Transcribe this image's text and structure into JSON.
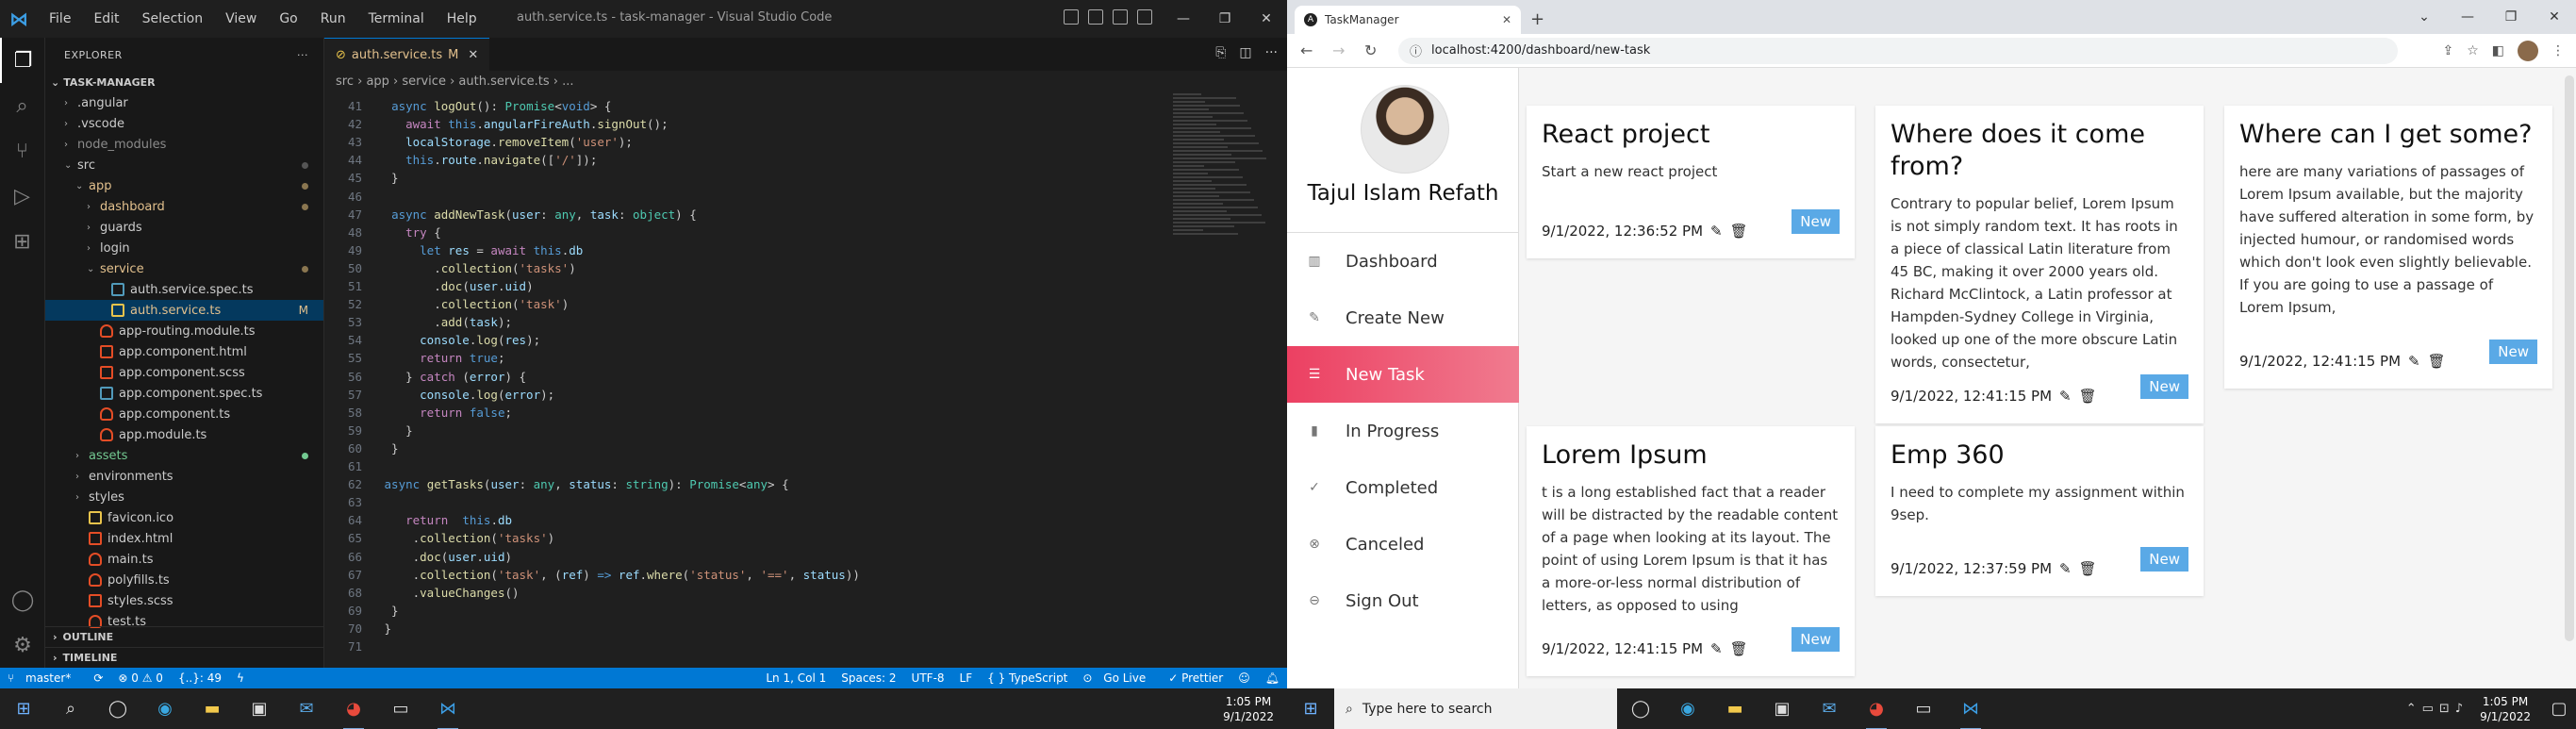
{
  "vscode": {
    "menu": [
      "File",
      "Edit",
      "Selection",
      "View",
      "Go",
      "Run",
      "Terminal",
      "Help"
    ],
    "window_title": "auth.service.ts - task-manager - Visual Studio Code",
    "explorer_title": "EXPLORER",
    "project": "TASK-MANAGER",
    "tree": [
      {
        "label": ".angular",
        "depth": 1,
        "type": "folder",
        "chev": "›"
      },
      {
        "label": ".vscode",
        "depth": 1,
        "type": "folder",
        "chev": "›"
      },
      {
        "label": "node_modules",
        "depth": 1,
        "type": "folder",
        "chev": "›",
        "dim": true
      },
      {
        "label": "src",
        "depth": 1,
        "type": "folder",
        "chev": "⌄",
        "dot": true
      },
      {
        "label": "app",
        "depth": 2,
        "type": "folder",
        "chev": "⌄",
        "dot": true,
        "color": "#e2c08d"
      },
      {
        "label": "dashboard",
        "depth": 3,
        "type": "folder",
        "chev": "›",
        "dot": true,
        "color": "#e2c08d"
      },
      {
        "label": "guards",
        "depth": 3,
        "type": "folder",
        "chev": "›"
      },
      {
        "label": "login",
        "depth": 3,
        "type": "folder",
        "chev": "›"
      },
      {
        "label": "service",
        "depth": 3,
        "type": "folder",
        "chev": "⌄",
        "dot": true,
        "color": "#e2c08d"
      },
      {
        "label": "auth.service.spec.ts",
        "depth": 4,
        "type": "spec"
      },
      {
        "label": "auth.service.ts",
        "depth": 4,
        "type": "ts",
        "badge": "M",
        "color": "#e2c08d",
        "sel": true
      },
      {
        "label": "app-routing.module.ts",
        "depth": 3,
        "type": "ng"
      },
      {
        "label": "app.component.html",
        "depth": 3,
        "type": "html"
      },
      {
        "label": "app.component.scss",
        "depth": 3,
        "type": "scss"
      },
      {
        "label": "app.component.spec.ts",
        "depth": 3,
        "type": "spec"
      },
      {
        "label": "app.component.ts",
        "depth": 3,
        "type": "ng"
      },
      {
        "label": "app.module.ts",
        "depth": 3,
        "type": "ng"
      },
      {
        "label": "assets",
        "depth": 2,
        "type": "folder",
        "chev": "›",
        "dot": true,
        "color": "#73c991"
      },
      {
        "label": "environments",
        "depth": 2,
        "type": "folder",
        "chev": "›"
      },
      {
        "label": "styles",
        "depth": 2,
        "type": "folder",
        "chev": "›"
      },
      {
        "label": "favicon.ico",
        "depth": 2,
        "type": "ico"
      },
      {
        "label": "index.html",
        "depth": 2,
        "type": "html"
      },
      {
        "label": "main.ts",
        "depth": 2,
        "type": "ng"
      },
      {
        "label": "polyfills.ts",
        "depth": 2,
        "type": "ng"
      },
      {
        "label": "styles.scss",
        "depth": 2,
        "type": "scss"
      },
      {
        "label": "test.ts",
        "depth": 2,
        "type": "ng"
      }
    ],
    "outline": "OUTLINE",
    "timeline": "TIMELINE",
    "tab": {
      "label": "auth.service.ts",
      "mod": "M"
    },
    "breadcrumb": "src › app › service › auth.service.ts › ...",
    "code": [
      {
        "n": "41",
        "h": "  <span class='k'>async</span> <span class='f'>logOut</span>(): <span class='t'>Promise</span>&lt;<span class='k'>void</span>&gt; {"
      },
      {
        "n": "42",
        "h": "    <span class='kc'>await</span> <span class='k'>this</span>.<span class='v'>angularFireAuth</span>.<span class='f'>signOut</span>();"
      },
      {
        "n": "43",
        "h": "    <span class='v'>localStorage</span>.<span class='f'>removeItem</span>(<span class='s'>'user'</span>);"
      },
      {
        "n": "44",
        "h": "    <span class='k'>this</span>.<span class='v'>route</span>.<span class='f'>navigate</span>([<span class='s'>'/'</span>]);"
      },
      {
        "n": "45",
        "h": "  }"
      },
      {
        "n": "46",
        "h": ""
      },
      {
        "n": "47",
        "h": "  <span class='k'>async</span> <span class='f'>addNewTask</span>(<span class='v'>user</span>: <span class='t'>any</span>, <span class='v'>task</span>: <span class='t'>object</span>) {"
      },
      {
        "n": "48",
        "h": "    <span class='kc'>try</span> {"
      },
      {
        "n": "49",
        "h": "      <span class='k'>let</span> <span class='v'>res</span> = <span class='kc'>await</span> <span class='k'>this</span>.<span class='v'>db</span>"
      },
      {
        "n": "50",
        "h": "        .<span class='f'>collection</span>(<span class='s'>'tasks'</span>)"
      },
      {
        "n": "51",
        "h": "        .<span class='f'>doc</span>(<span class='v'>user</span>.<span class='v'>uid</span>)"
      },
      {
        "n": "52",
        "h": "        .<span class='f'>collection</span>(<span class='s'>'task'</span>)"
      },
      {
        "n": "53",
        "h": "        .<span class='f'>add</span>(<span class='v'>task</span>);"
      },
      {
        "n": "54",
        "h": "      <span class='v'>console</span>.<span class='f'>log</span>(<span class='v'>res</span>);"
      },
      {
        "n": "55",
        "h": "      <span class='kc'>return</span> <span class='k'>true</span>;"
      },
      {
        "n": "56",
        "h": "    } <span class='kc'>catch</span> (<span class='v'>error</span>) {"
      },
      {
        "n": "57",
        "h": "      <span class='v'>console</span>.<span class='f'>log</span>(<span class='v'>error</span>);"
      },
      {
        "n": "58",
        "h": "      <span class='kc'>return</span> <span class='k'>false</span>;"
      },
      {
        "n": "59",
        "h": "    }"
      },
      {
        "n": "60",
        "h": "  }"
      },
      {
        "n": "61",
        "h": ""
      },
      {
        "n": "62",
        "h": " <span class='k'>async</span> <span class='f'>getTasks</span>(<span class='v'>user</span>: <span class='t'>any</span>, <span class='v'>status</span>: <span class='t'>string</span>): <span class='t'>Promise</span>&lt;<span class='t'>any</span>&gt; {"
      },
      {
        "n": "63",
        "h": ""
      },
      {
        "n": "64",
        "h": "    <span class='kc'>return</span>  <span class='k'>this</span>.<span class='v'>db</span>"
      },
      {
        "n": "65",
        "h": "     .<span class='f'>collection</span>(<span class='s'>'tasks'</span>)"
      },
      {
        "n": "66",
        "h": "     .<span class='f'>doc</span>(<span class='v'>user</span>.<span class='v'>uid</span>)"
      },
      {
        "n": "67",
        "h": "     .<span class='f'>collection</span>(<span class='s'>'task'</span>, (<span class='v'>ref</span>) <span class='k'>=&gt;</span> <span class='v'>ref</span>.<span class='f'>where</span>(<span class='s'>'status'</span>, <span class='s'>'=='</span>, <span class='v'>status</span>))"
      },
      {
        "n": "68",
        "h": "     .<span class='f'>valueChanges</span>()"
      },
      {
        "n": "69",
        "h": "  }"
      },
      {
        "n": "70",
        "h": " }"
      },
      {
        "n": "71",
        "h": ""
      }
    ],
    "status": {
      "branch": "master*",
      "errors": "⊗ 0 ⚠ 0",
      "pos_ext": "{..}: 49",
      "cursor": "Ln 1, Col 1",
      "spaces": "Spaces: 2",
      "enc": "UTF-8",
      "eol": "LF",
      "lang": "{ } TypeScript",
      "live": "Go Live",
      "prettier": "✓ Prettier"
    }
  },
  "chrome": {
    "tab_title": "TaskManager",
    "url": "localhost:4200/dashboard/new-task",
    "user_name": "Tajul Islam Refath",
    "nav": [
      {
        "label": "Dashboard",
        "icon": "▥"
      },
      {
        "label": "Create New",
        "icon": "✎"
      },
      {
        "label": "New Task",
        "icon": "☰",
        "active": true
      },
      {
        "label": "In Progress",
        "icon": "▮"
      },
      {
        "label": "Completed",
        "icon": "✓"
      },
      {
        "label": "Canceled",
        "icon": "⊗"
      },
      {
        "label": "Sign Out",
        "icon": "⊖"
      }
    ],
    "badge_label": "New",
    "cards": [
      {
        "title": "React project",
        "desc": "Start a new react project",
        "date": "9/1/2022, 12:36:52 PM"
      },
      {
        "title": "Where does it come from?",
        "desc": "Contrary to popular belief, Lorem Ipsum is not simply random text. It has roots in a piece of classical Latin literature from 45 BC, making it over 2000 years old. Richard McClintock, a Latin professor at Hampden-Sydney College in Virginia, looked up one of the more obscure Latin words, consectetur,",
        "date": "9/1/2022, 12:41:15 PM"
      },
      {
        "title": "Where can I get some?",
        "desc": "here are many variations of passages of Lorem Ipsum available, but the majority have suffered alteration in some form, by injected humour, or randomised words which don't look even slightly believable. If you are going to use a passage of Lorem Ipsum,",
        "date": "9/1/2022, 12:41:15 PM"
      },
      {
        "title": "Lorem Ipsum",
        "desc": "t is a long established fact that a reader will be distracted by the readable content of a page when looking at its layout. The point of using Lorem Ipsum is that it has a more-or-less normal distribution of letters, as opposed to using",
        "date": "9/1/2022, 12:41:15 PM"
      },
      {
        "title": "Emp 360",
        "desc": "I need to complete my assignment within 9sep.",
        "date": "9/1/2022, 12:37:59 PM"
      }
    ]
  },
  "taskbar": {
    "left_time": "1:05 PM",
    "left_date": "9/1/2022",
    "search_placeholder": "Type here to search",
    "right_time": "1:05 PM",
    "right_date": "9/1/2022"
  }
}
